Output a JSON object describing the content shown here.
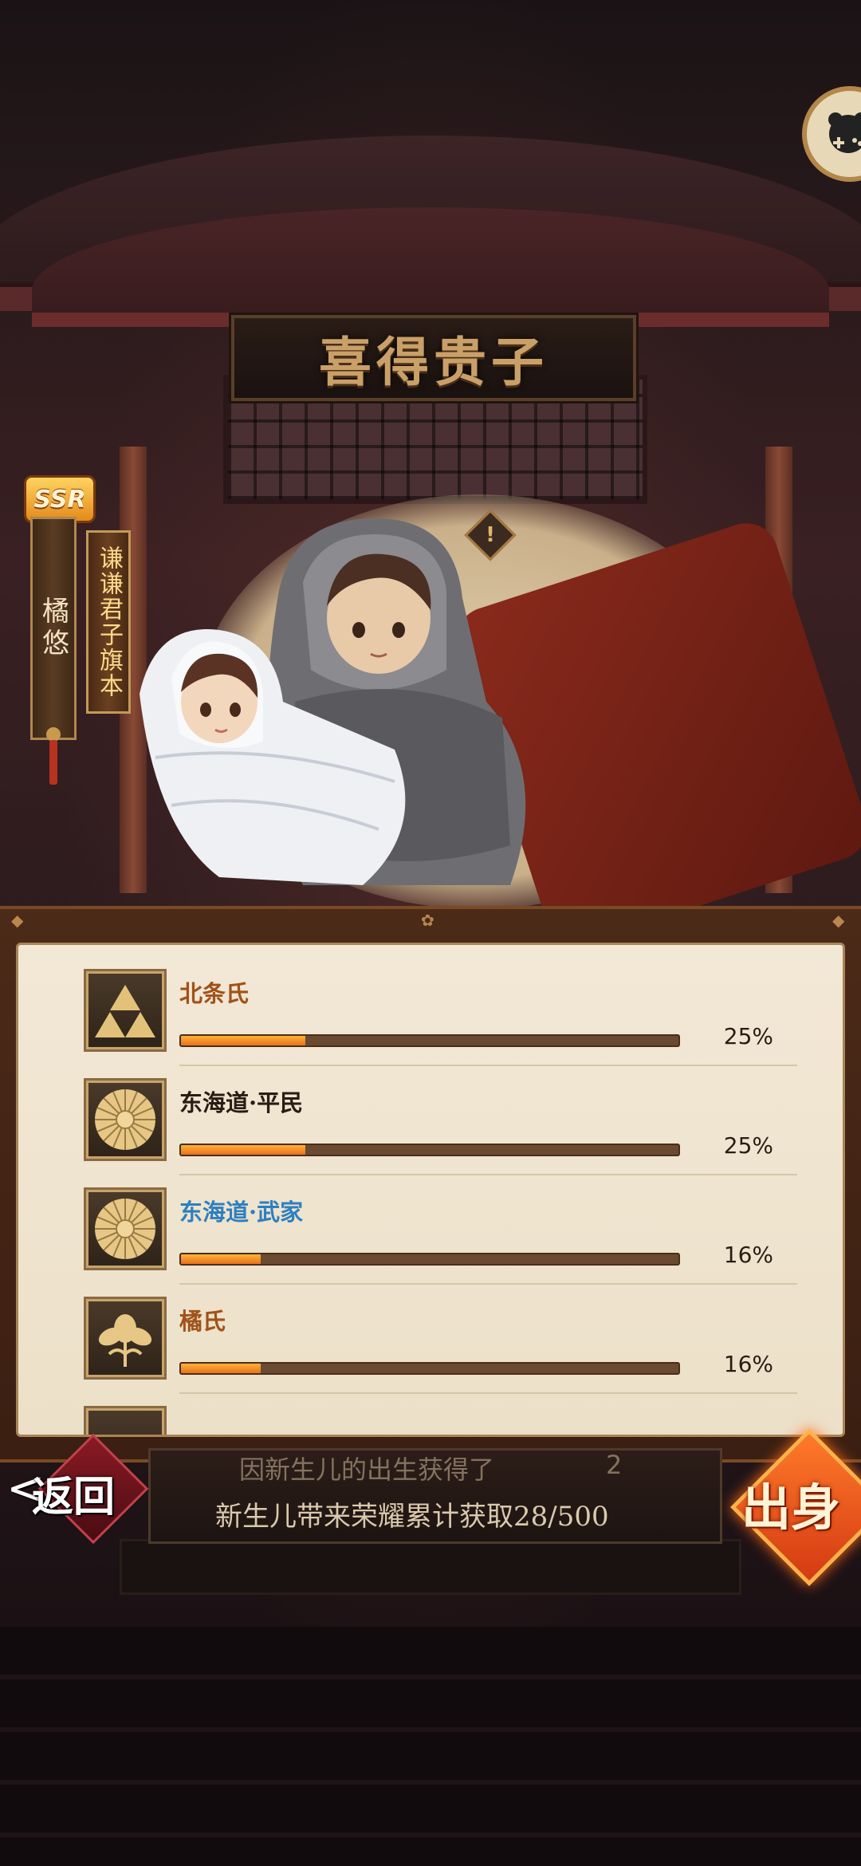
{
  "header": {
    "title": "喜得贵子"
  },
  "child": {
    "rarity": "SSR",
    "name": "橘悠",
    "rank_title": "谦谦君子旗本"
  },
  "alert_symbol": "!",
  "icons": {
    "top_right": "gamepad-icon",
    "alert": "exclamation-icon"
  },
  "origins": [
    {
      "name": "北条氏",
      "percent": "25%",
      "value": 0.25,
      "icon": "triforce-crest-icon",
      "name_color": "#a0521a"
    },
    {
      "name": "东海道·平民",
      "percent": "25%",
      "value": 0.25,
      "icon": "chrysanthemum-crest-icon",
      "name_color": "#2a1c14"
    },
    {
      "name": "东海道·武家",
      "percent": "16%",
      "value": 0.16,
      "icon": "chrysanthemum-crest-icon",
      "name_color": "#2e7fc0"
    },
    {
      "name": "橘氏",
      "percent": "16%",
      "value": 0.16,
      "icon": "tachibana-crest-icon",
      "name_color": "#a0521a"
    }
  ],
  "info": {
    "line1_partial": "因新生儿的出生获得了",
    "line1_count": "2",
    "line2": "新生儿带来荣耀累计获取28/500"
  },
  "buttons": {
    "back_label": "返回",
    "origin_label": "出身"
  },
  "colors": {
    "progress_fill": "#f08a24",
    "panel_bg": "#f2e8d6",
    "accent_orange": "#e8721c"
  }
}
